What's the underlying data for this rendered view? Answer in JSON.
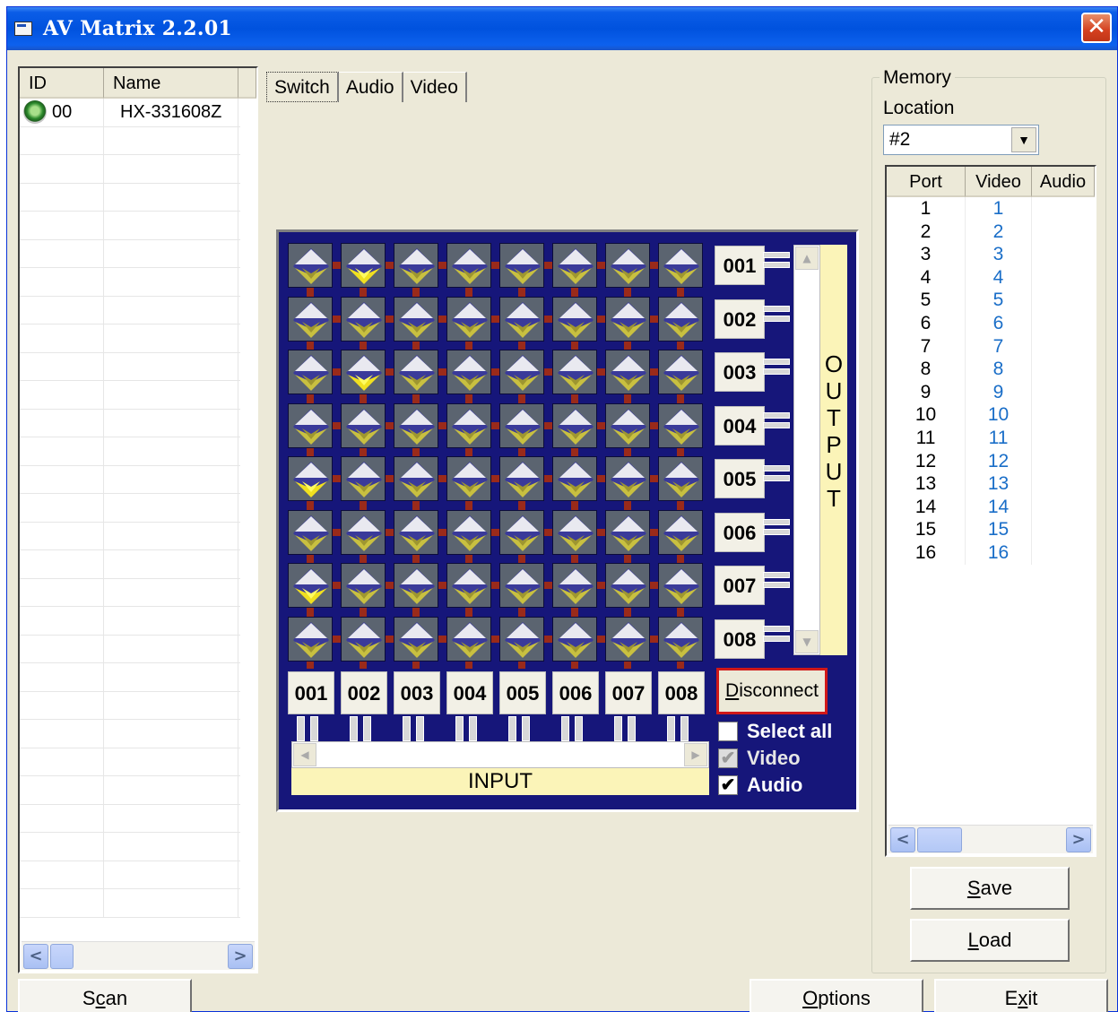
{
  "window": {
    "title": "AV Matrix 2.2.01",
    "close_glyph": "✕"
  },
  "devices": {
    "columns": [
      "ID",
      "Name"
    ],
    "rows": [
      {
        "id": "00",
        "name": "HX-331608Z",
        "status_icon": "green-led-icon"
      }
    ]
  },
  "tabs": [
    "Switch",
    "Audio",
    "Video"
  ],
  "matrix": {
    "outputs": [
      "001",
      "002",
      "003",
      "004",
      "005",
      "006",
      "007",
      "008"
    ],
    "inputs": [
      "001",
      "002",
      "003",
      "004",
      "005",
      "006",
      "007",
      "008"
    ],
    "active_input_per_output": [
      2,
      0,
      2,
      0,
      1,
      0,
      1,
      0
    ],
    "output_label": "OUTPUT",
    "input_label": "INPUT",
    "disconnect_label": "Disconnect",
    "checkboxes": [
      {
        "label": "Select all",
        "checked": false,
        "disabled": false
      },
      {
        "label": "Video",
        "checked": true,
        "disabled": true
      },
      {
        "label": "Audio",
        "checked": true,
        "disabled": false
      }
    ],
    "colors": {
      "panel": "#16167a",
      "active": "#f0e020",
      "inactive": "#c8c040",
      "link": "#9a2a1a"
    }
  },
  "memory": {
    "group_title": "Memory",
    "location_label": "Location",
    "location_value": "#2",
    "columns": [
      "Port",
      "Video",
      "Audio"
    ],
    "rows": [
      {
        "port": "1",
        "video": "1"
      },
      {
        "port": "2",
        "video": "2"
      },
      {
        "port": "3",
        "video": "3"
      },
      {
        "port": "4",
        "video": "4"
      },
      {
        "port": "5",
        "video": "5"
      },
      {
        "port": "6",
        "video": "6"
      },
      {
        "port": "7",
        "video": "7"
      },
      {
        "port": "8",
        "video": "8"
      },
      {
        "port": "9",
        "video": "9"
      },
      {
        "port": "10",
        "video": "10"
      },
      {
        "port": "11",
        "video": "11"
      },
      {
        "port": "12",
        "video": "12"
      },
      {
        "port": "13",
        "video": "13"
      },
      {
        "port": "14",
        "video": "14"
      },
      {
        "port": "15",
        "video": "15"
      },
      {
        "port": "16",
        "video": "16"
      }
    ],
    "save_label": "Save",
    "load_label": "Load"
  },
  "bottom": {
    "scan_label": "Scan",
    "options_label": "Options",
    "exit_label": "Exit"
  }
}
